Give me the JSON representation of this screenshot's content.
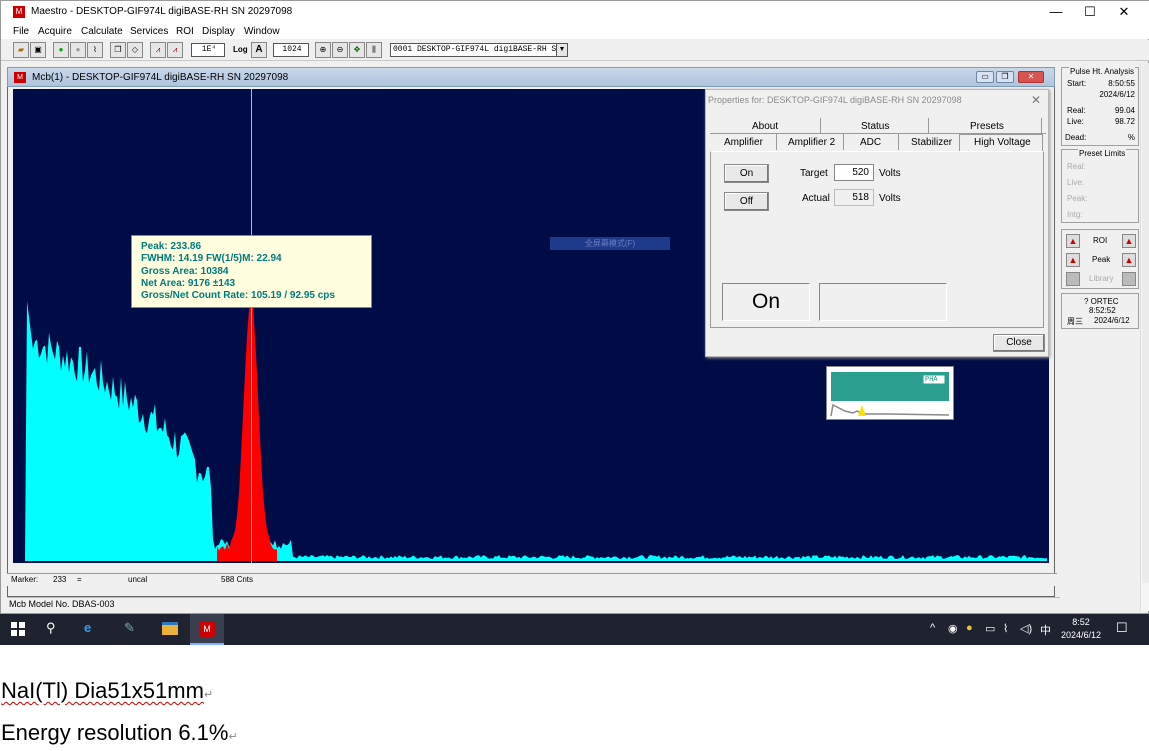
{
  "window": {
    "title": "Maestro - DESKTOP-GIF974L digiBASE-RH SN 20297098",
    "min": "—",
    "max": "☐",
    "close": "✕"
  },
  "menu": [
    "File",
    "Acquire",
    "Calculate",
    "Services",
    "ROI",
    "Display",
    "Window"
  ],
  "toolbar": {
    "group_box": "1E⁴",
    "log_label": "Log",
    "a_label": "A",
    "channels": "1024",
    "detector_select": "0001  DESKTOP-GIF974L digiBASE-RH SN"
  },
  "mcb": {
    "title": "Mcb(1) - DESKTOP-GIF974L digiBASE-RH SN 20297098"
  },
  "tooltip": {
    "peak": "Peak: 233.86",
    "fwhm": "FWHM: 14.19  FW(1/5)M: 22.94",
    "gross": "Gross Area: 10384",
    "net": "Net Area: 9176 ±143",
    "rate": "Gross/Net Count Rate: 105.19 / 92.95 cps"
  },
  "ghost_label": "全屏幕模式(F)",
  "properties": {
    "title": "Properties for: DESKTOP-GIF974L digiBASE-RH SN 20297098",
    "tabs_row1": [
      "About",
      "Status",
      "Presets"
    ],
    "tabs_row2": [
      "Amplifier",
      "Amplifier 2",
      "ADC",
      "Stabilizer",
      "High Voltage"
    ],
    "on_button": "On",
    "off_button": "Off",
    "target_label": "Target",
    "target_value": "520",
    "actual_label": "Actual",
    "actual_value": "518",
    "volts": "Volts",
    "state": "On",
    "close_button": "Close"
  },
  "mini": {
    "label": "PHA"
  },
  "marker_bar": {
    "marker_label": "Marker:",
    "marker_value": "233",
    "eq": "=",
    "uncal": "uncal",
    "cnts": "588  Cnts"
  },
  "status_bar": "Mcb Model No. DBAS-003",
  "pulse_analysis": {
    "title": "Pulse Ht. Analysis",
    "start_label": "Start:",
    "start_time": "8:50:55",
    "start_date": "2024/6/12",
    "real_label": "Real:",
    "real_value": "99.04",
    "live_label": "Live:",
    "live_value": "98.72",
    "dead_label": "Dead:",
    "dead_value": "%"
  },
  "preset_limits": {
    "title": "Preset Limits",
    "items": [
      "Real:",
      "Live:",
      "Peak:",
      "Intg:"
    ]
  },
  "roi_panel": {
    "roi": "ROI",
    "peak": "Peak",
    "library": "Library"
  },
  "clock_panel": {
    "brand": "? ORTEC",
    "time": "8:52:52",
    "weekday": "周三",
    "date": "2024/6/12"
  },
  "taskbar": {
    "time": "8:52",
    "date": "2024/6/12",
    "ime": "中"
  },
  "caption": {
    "line1": "NaI(Tl) Dia51x51mm",
    "line2": "Energy resolution 6.1%",
    "mark": "↵"
  },
  "colors": {
    "plot_bg": "#000c46",
    "spectrum": "#00ffff",
    "roi": "#ff0000",
    "tooltip_text": "#007a7a"
  }
}
